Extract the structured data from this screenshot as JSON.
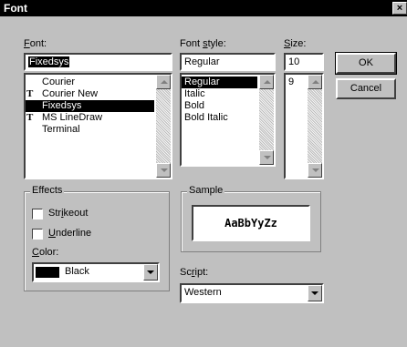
{
  "window": {
    "title": "Font",
    "close_glyph": "×"
  },
  "font": {
    "label": "Font:",
    "value": "Fixedsys",
    "items": [
      {
        "name": "Courier",
        "icon": ""
      },
      {
        "name": "Courier New",
        "icon": "truetype-icon"
      },
      {
        "name": "Fixedsys",
        "icon": "",
        "selected": true
      },
      {
        "name": "MS LineDraw",
        "icon": "truetype-icon"
      },
      {
        "name": "Terminal",
        "icon": ""
      }
    ],
    "truetype_glyph": "T"
  },
  "font_style": {
    "label": "Font style:",
    "value": "Regular",
    "items": [
      {
        "name": "Regular",
        "selected": true
      },
      {
        "name": "Italic"
      },
      {
        "name": "Bold"
      },
      {
        "name": "Bold Italic"
      }
    ]
  },
  "size": {
    "label": "Size:",
    "value": "10",
    "items": [
      "9"
    ]
  },
  "buttons": {
    "ok": "OK",
    "cancel": "Cancel"
  },
  "effects": {
    "label": "Effects",
    "strikeout": "Strikeout",
    "underline": "Underline",
    "color_label": "Color:",
    "color_value": "Black",
    "color_swatch": "#000000"
  },
  "sample": {
    "label": "Sample",
    "text": "AaBbYyZz"
  },
  "script": {
    "label": "Script:",
    "value": "Western"
  }
}
